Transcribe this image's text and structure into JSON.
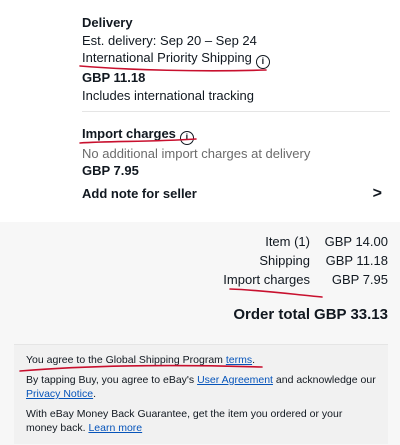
{
  "delivery": {
    "heading": "Delivery",
    "estimate": "Est. delivery: Sep 20 – Sep 24",
    "method": "International Priority Shipping",
    "price": "GBP 11.18",
    "tracking": "Includes international tracking"
  },
  "import": {
    "heading": "Import charges",
    "note": "No additional import charges at delivery",
    "price": "GBP 7.95"
  },
  "note_for_seller": {
    "label": "Add note for seller",
    "chevron": "›"
  },
  "summary": {
    "rows": [
      {
        "label": "Item (1)",
        "value": "GBP 14.00"
      },
      {
        "label": "Shipping",
        "value": "GBP 11.18"
      },
      {
        "label": "Import charges",
        "value": "GBP 7.95"
      }
    ],
    "total_label": "Order total",
    "total_value": "GBP 33.13"
  },
  "legal": {
    "gsp_prefix": "You agree to the Global Shipping Program ",
    "gsp_link": "terms",
    "gsp_suffix": ".",
    "tap_prefix": "By tapping Buy, you agree to eBay's ",
    "user_agreement": "User Agreement",
    "tap_middle": " and acknowledge our ",
    "privacy_notice": "Privacy Notice",
    "tap_suffix": ".",
    "mbg_text": "With eBay Money Back Guarantee, get the item you ordered or your money back. ",
    "learn_more": "Learn more"
  },
  "colors": {
    "link": "#0654ba",
    "ink": "#c8102e",
    "band": "#f7f7f7"
  },
  "icons": {
    "info": "info-circle-icon",
    "chevron": "chevron-right-icon"
  }
}
